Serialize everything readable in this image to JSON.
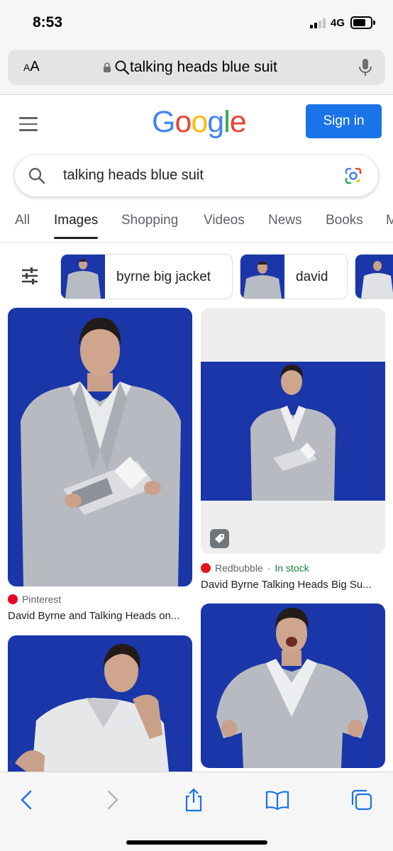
{
  "status_bar": {
    "time": "8:53",
    "network": "4G"
  },
  "address_bar": {
    "text_size_label_small": "A",
    "text_size_label_large": "A",
    "url": "talking heads blue suit"
  },
  "header": {
    "logo": [
      "G",
      "o",
      "o",
      "g",
      "l",
      "e"
    ],
    "logo_colors": [
      "#4285F4",
      "#EA4335",
      "#FBBC05",
      "#4285F4",
      "#34A853",
      "#EA4335"
    ],
    "sign_in": "Sign in"
  },
  "search": {
    "query": "talking heads blue suit"
  },
  "tabs": [
    {
      "label": "All"
    },
    {
      "label": "Images"
    },
    {
      "label": "Shopping"
    },
    {
      "label": "Videos"
    },
    {
      "label": "News"
    },
    {
      "label": "Books"
    }
  ],
  "chips": [
    {
      "label": "byrne big jacket"
    },
    {
      "label": "david"
    }
  ],
  "results": [
    {
      "source": "Pinterest",
      "title": "David Byrne and Talking Heads on..."
    },
    {
      "source": "Redbubble",
      "stock": "In stock",
      "separator": "·",
      "title": "David Byrne Talking Heads Big Su..."
    }
  ],
  "colors": {
    "accent": "#1a73e8",
    "image_background": "#1b36a8",
    "in_stock": "#188038"
  }
}
